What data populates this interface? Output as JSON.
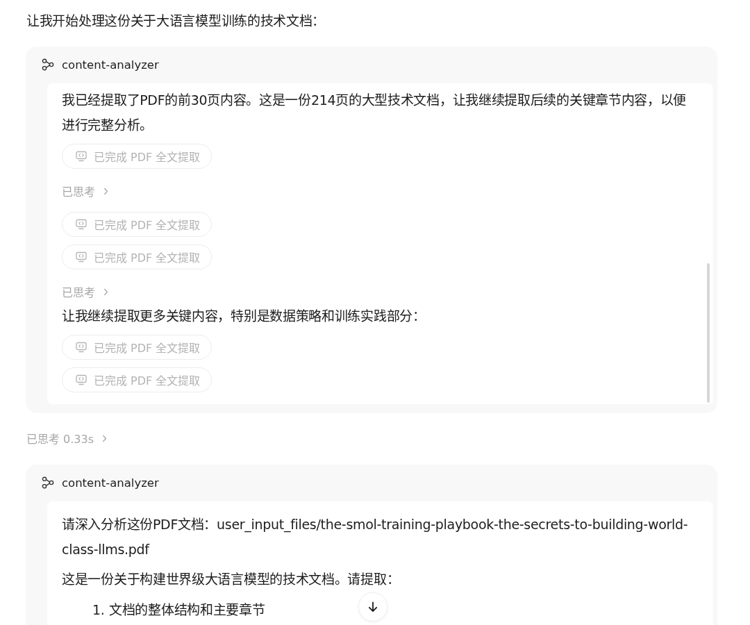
{
  "feed": [
    {
      "kind": "text",
      "text": "让我开始处理这份关于大语言模型训练的技术文档："
    },
    {
      "kind": "agent_card",
      "agent": "content-analyzer",
      "scrollbar": true,
      "blocks": [
        {
          "kind": "text",
          "text": "我已经提取了PDF的前30页内容。这是一份214页的大型技术文档，让我继续提取后续的关键章节内容，以便进行完整分析。"
        },
        {
          "kind": "tool",
          "label": "已完成 PDF 全文提取"
        },
        {
          "kind": "thinking",
          "label": "已思考"
        },
        {
          "kind": "tool",
          "label": "已完成 PDF 全文提取"
        },
        {
          "kind": "tool",
          "label": "已完成 PDF 全文提取"
        },
        {
          "kind": "thinking",
          "label": "已思考"
        },
        {
          "kind": "text",
          "text": "让我继续提取更多关键内容，特别是数据策略和训练实践部分："
        },
        {
          "kind": "tool",
          "label": "已完成 PDF 全文提取"
        },
        {
          "kind": "tool",
          "label": "已完成 PDF 全文提取"
        }
      ]
    },
    {
      "kind": "thinking",
      "label": "已思考 0.33s"
    },
    {
      "kind": "agent_card",
      "agent": "content-analyzer",
      "scrollbar": false,
      "blocks": [
        {
          "kind": "text",
          "text": "请深入分析这份PDF文档：user_input_files/the-smol-training-playbook-the-secrets-to-building-world-class-llms.pdf"
        },
        {
          "kind": "text",
          "text": "这是一份关于构建世界级大语言模型的技术文档。请提取："
        },
        {
          "kind": "list",
          "items": [
            {
              "number": "1.",
              "text": "文档的整体结构和主要章节"
            }
          ]
        }
      ]
    }
  ]
}
